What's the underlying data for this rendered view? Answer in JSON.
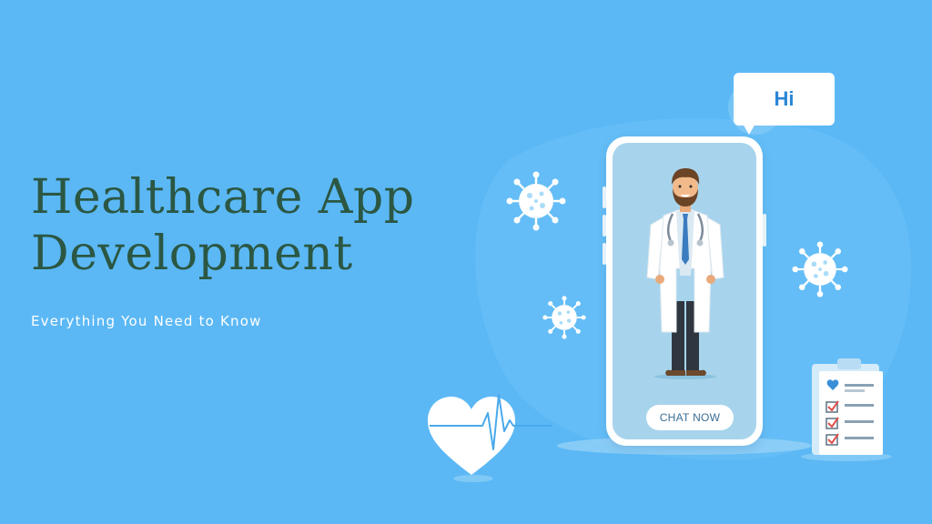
{
  "title": {
    "line1": "Healthcare App",
    "line2": "Development"
  },
  "subtitle": "Everything You Need to Know",
  "speech_bubble": {
    "text": "Hi"
  },
  "phone": {
    "cta_label": "CHAT NOW"
  },
  "colors": {
    "background": "#5bb8f5",
    "title": "#2b5743",
    "phone_screen": "#a7d4ec",
    "accent_blue": "#2a86d6"
  },
  "icons": [
    "virus-icon",
    "heartbeat-icon",
    "clipboard-checklist-icon",
    "doctor-illustration"
  ]
}
